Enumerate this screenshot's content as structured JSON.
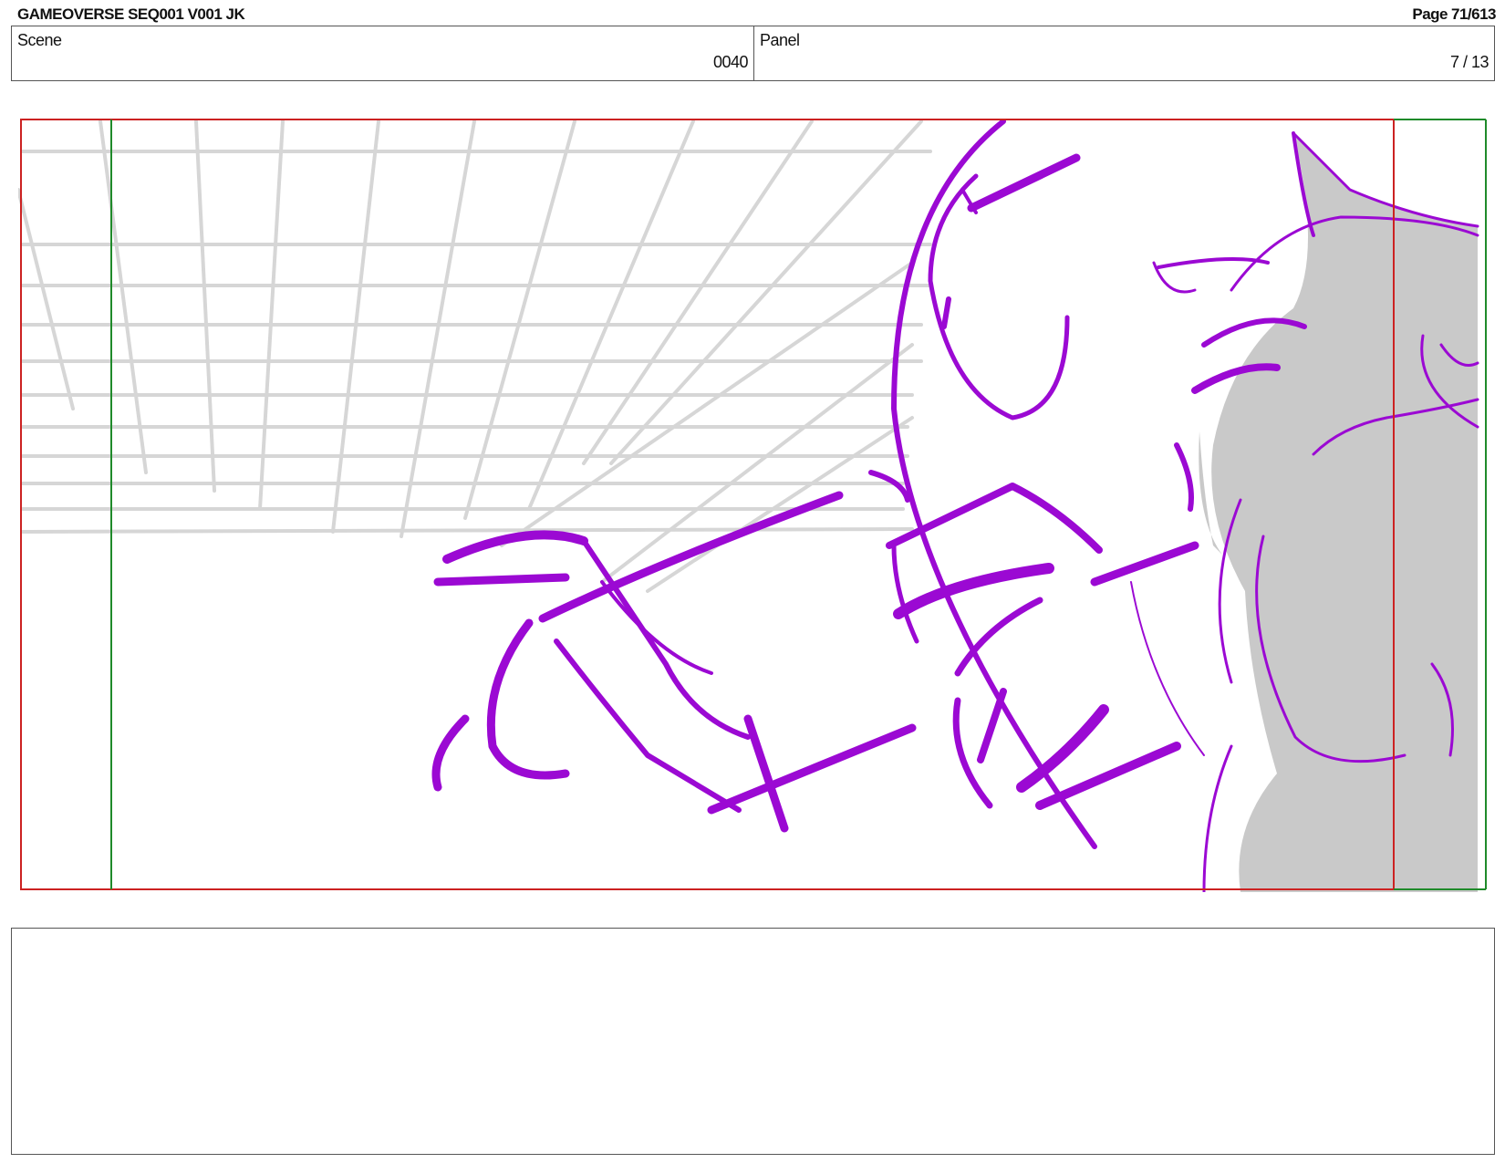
{
  "header": {
    "title": "GAMEOVERSE SEQ001 V001 JK",
    "page_label": "Page",
    "page_value": "71/613"
  },
  "info": {
    "scene_label": "Scene",
    "scene_value": "0040",
    "panel_label": "Panel",
    "panel_value": "7 / 13"
  },
  "colors": {
    "sketch": "#9b09d3",
    "safe_frame": "#cc2222",
    "camera_frame": "#1f8a2a",
    "guide_lines": "#d6d6d6",
    "tone_fill": "#c9c9c9"
  },
  "notes": {
    "text": ""
  }
}
